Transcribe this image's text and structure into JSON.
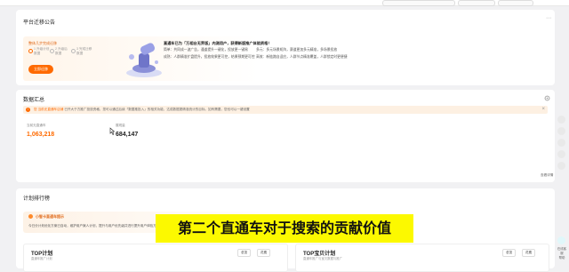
{
  "announcement": {
    "title": "平台迁移公告",
    "steps_title": "整体几步完成迁移",
    "steps": [
      "1 升级计划",
      "2 升级后",
      "3 完成迁移"
    ],
    "steps_sub": [
      "数据",
      "数据",
      "数据"
    ],
    "button": "立即迁移",
    "headline": "直通车已为「万相台无界版」内测用户，获得新版推广体验资格！",
    "line1": "简单：共同成一波广告，通道提升一键化，投放更一键易",
    "line2": "成熟：人群精准扩盘提升，投放效果更可控，结果预期更可控",
    "line3_a": "多元：多元场景矩阵，赛道更加多元精准，多场景投放",
    "line3_b": "高效：新链路自适应，人群节点精准覆盖，人群锁定时更便捷"
  },
  "data_summary": {
    "title": "数据汇总",
    "banner_prefix": "您",
    "banner_link": "当前无直通车店铺",
    "banner_text": "已开大于方推广投放资格，您可以通过后续「数据推投入」的相关功能，达成数据更精准统计的目标。如有需要，您也可以一键设置",
    "metrics": [
      {
        "label": "当前无直通车",
        "value": "1,063,218"
      },
      {
        "label": "展现量",
        "value": "684,147"
      }
    ],
    "footer_link": "查看详情"
  },
  "rank": {
    "title": "计划排行榜",
    "tip_title": "小智卡直通车提示",
    "tip_text": "今日分计划优化方案已自动，维护用户案人计划，提升与用户优先级并进行提升用户体验方案",
    "left_panel": {
      "title": "TOP计划",
      "subtitle": "直通车推广计划",
      "sel1": "总览",
      "sel2": "花费"
    },
    "right_panel": {
      "title": "TOP宝贝计划",
      "subtitle": "直通车推广与宝贝数据与推广",
      "sel1": "总览",
      "sel2": "花费"
    }
  },
  "subtitle": "第二个直通车对于搜索的贡献价值",
  "side": {
    "label1": "在线客服",
    "label2": "帮助"
  },
  "colors": {
    "accent": "#ff6a00",
    "subtitle_bg": "#fcf900"
  }
}
